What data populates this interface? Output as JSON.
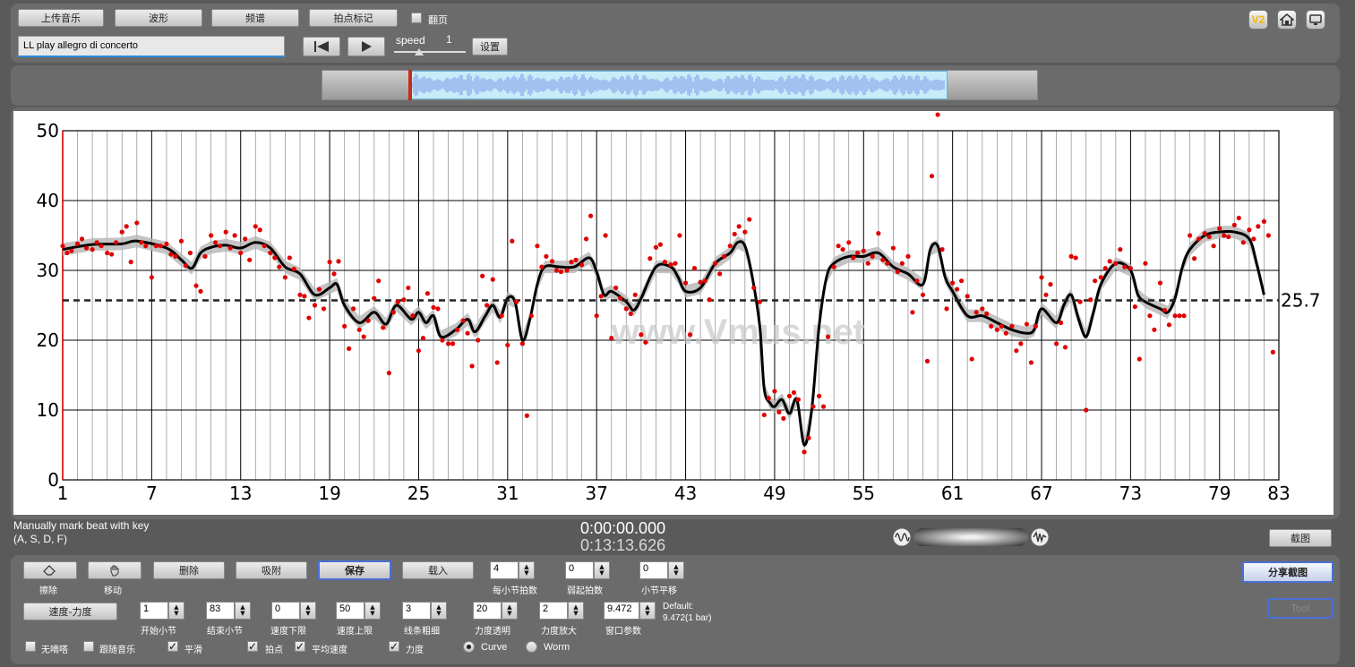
{
  "toolbar": {
    "upload": "上传音乐",
    "waveform": "波形",
    "spectrum": "频谱",
    "beat_mark": "拍点标记",
    "page_turn": "翻页",
    "set": "设置"
  },
  "track": {
    "title": "LL play allegro di concerto"
  },
  "speed": {
    "label": "speed",
    "value": "1"
  },
  "top_icons": {
    "v2": "V2"
  },
  "chart_data": {
    "type": "scatter",
    "ylim": [
      0,
      50
    ],
    "xlim": [
      1,
      83
    ],
    "yticks": [
      "0",
      "10",
      "20",
      "30",
      "40",
      "50"
    ],
    "xticks": [
      "1",
      "7",
      "13",
      "19",
      "25",
      "31",
      "37",
      "43",
      "49",
      "55",
      "61",
      "67",
      "73",
      "79",
      "83"
    ],
    "mean_label": "25.7",
    "mean": 25.7,
    "watermark": "www.Vmus.net",
    "point_color": "#e00000",
    "curve_color": "#000000",
    "curve": [
      [
        1,
        33
      ],
      [
        3,
        33.7
      ],
      [
        5,
        33.8
      ],
      [
        6,
        34.2
      ],
      [
        8,
        33.2
      ],
      [
        9,
        31.5
      ],
      [
        9.7,
        30.3
      ],
      [
        10.3,
        32.5
      ],
      [
        11,
        33.3
      ],
      [
        12,
        33.6
      ],
      [
        13,
        33.2
      ],
      [
        14,
        34
      ],
      [
        15,
        33.2
      ],
      [
        16,
        30.5
      ],
      [
        17,
        29.5
      ],
      [
        18,
        26.5
      ],
      [
        19,
        27.5
      ],
      [
        19.5,
        28
      ],
      [
        20,
        25
      ],
      [
        21,
        22.5
      ],
      [
        22,
        24
      ],
      [
        22.8,
        22.3
      ],
      [
        23.5,
        25
      ],
      [
        24.5,
        23
      ],
      [
        25,
        24
      ],
      [
        25.5,
        22.5
      ],
      [
        26,
        23.5
      ],
      [
        26.5,
        20.5
      ],
      [
        27.5,
        21.5
      ],
      [
        28.3,
        23
      ],
      [
        28.8,
        21.2
      ],
      [
        29.5,
        23.5
      ],
      [
        30,
        25
      ],
      [
        30.5,
        23.3
      ],
      [
        31,
        26
      ],
      [
        31.5,
        25.5
      ],
      [
        32,
        20
      ],
      [
        32.5,
        23
      ],
      [
        33,
        28
      ],
      [
        33.5,
        30.5
      ],
      [
        34.5,
        30.5
      ],
      [
        35.5,
        30.5
      ],
      [
        36.5,
        31.8
      ],
      [
        37,
        29.8
      ],
      [
        37.5,
        26.5
      ],
      [
        38,
        27
      ],
      [
        39,
        25.5
      ],
      [
        39.5,
        24.3
      ],
      [
        40,
        26
      ],
      [
        41,
        30.5
      ],
      [
        42,
        30.5
      ],
      [
        42.5,
        29
      ],
      [
        43,
        27
      ],
      [
        44,
        27.5
      ],
      [
        45,
        31
      ],
      [
        46,
        32.5
      ],
      [
        46.5,
        34
      ],
      [
        47,
        33.5
      ],
      [
        47.5,
        29
      ],
      [
        48,
        22
      ],
      [
        48.3,
        13
      ],
      [
        48.7,
        11
      ],
      [
        49,
        10.5
      ],
      [
        49.5,
        11.5
      ],
      [
        50,
        9.5
      ],
      [
        50.5,
        11.5
      ],
      [
        51,
        5
      ],
      [
        51.5,
        10
      ],
      [
        52,
        22
      ],
      [
        52.5,
        29
      ],
      [
        53,
        31
      ],
      [
        54,
        32
      ],
      [
        55,
        32
      ],
      [
        56,
        32.5
      ],
      [
        57,
        30.5
      ],
      [
        58,
        29.5
      ],
      [
        59,
        28
      ],
      [
        59.5,
        33
      ],
      [
        60,
        33.5
      ],
      [
        60.5,
        29
      ],
      [
        61,
        27
      ],
      [
        62,
        23.5
      ],
      [
        63,
        23.5
      ],
      [
        64,
        22.5
      ],
      [
        65,
        21.5
      ],
      [
        66,
        21
      ],
      [
        66.5,
        21.5
      ],
      [
        67,
        24.5
      ],
      [
        68,
        22.5
      ],
      [
        68.5,
        25
      ],
      [
        69,
        26.5
      ],
      [
        69.5,
        23
      ],
      [
        70,
        20.5
      ],
      [
        70.5,
        24
      ],
      [
        71,
        28
      ],
      [
        72,
        31
      ],
      [
        73,
        30
      ],
      [
        73.5,
        26.5
      ],
      [
        74,
        25.5
      ],
      [
        75,
        24.5
      ],
      [
        75.5,
        24
      ],
      [
        76,
        26
      ],
      [
        76.5,
        30.5
      ],
      [
        77,
        33
      ],
      [
        78,
        35
      ],
      [
        79,
        35.5
      ],
      [
        80,
        35.5
      ],
      [
        81,
        34.5
      ],
      [
        81.5,
        31
      ],
      [
        82,
        26.5
      ]
    ],
    "points": [
      [
        1,
        33.5
      ],
      [
        1.3,
        32.5
      ],
      [
        1.6,
        32.8
      ],
      [
        2,
        33.8
      ],
      [
        2.3,
        34.5
      ],
      [
        2.6,
        33.2
      ],
      [
        3,
        33
      ],
      [
        3.3,
        34
      ],
      [
        3.6,
        33.5
      ],
      [
        4,
        32.5
      ],
      [
        4.3,
        32.3
      ],
      [
        4.6,
        34
      ],
      [
        5,
        35.5
      ],
      [
        5.3,
        36.3
      ],
      [
        5.6,
        31.2
      ],
      [
        6,
        36.8
      ],
      [
        6.3,
        34
      ],
      [
        6.6,
        33.5
      ],
      [
        7,
        29
      ],
      [
        7.3,
        33.5
      ],
      [
        7.6,
        33.5
      ],
      [
        8,
        33.8
      ],
      [
        8.3,
        32.3
      ],
      [
        8.6,
        32
      ],
      [
        9,
        34.2
      ],
      [
        9.3,
        30.7
      ],
      [
        9.6,
        32.5
      ],
      [
        10,
        27.8
      ],
      [
        10.3,
        27
      ],
      [
        10.6,
        32
      ],
      [
        11,
        35
      ],
      [
        11.3,
        34
      ],
      [
        11.6,
        33.5
      ],
      [
        12,
        35.5
      ],
      [
        12.3,
        33.2
      ],
      [
        12.6,
        35
      ],
      [
        13,
        32.5
      ],
      [
        13.3,
        34.5
      ],
      [
        13.6,
        31.5
      ],
      [
        14,
        36.3
      ],
      [
        14.3,
        35.8
      ],
      [
        14.6,
        33.5
      ],
      [
        15,
        32.5
      ],
      [
        15.3,
        31.8
      ],
      [
        15.6,
        30.5
      ],
      [
        16,
        29
      ],
      [
        16.3,
        31.8
      ],
      [
        16.6,
        30.2
      ],
      [
        17,
        26.5
      ],
      [
        17.3,
        26.3
      ],
      [
        17.6,
        23.2
      ],
      [
        18,
        25
      ],
      [
        18.3,
        27.3
      ],
      [
        18.6,
        24.5
      ],
      [
        19,
        31.2
      ],
      [
        19.3,
        29.5
      ],
      [
        19.6,
        31.3
      ],
      [
        20,
        22
      ],
      [
        20.3,
        18.8
      ],
      [
        20.6,
        24.5
      ],
      [
        21,
        21.5
      ],
      [
        21.3,
        20.5
      ],
      [
        21.6,
        22.8
      ],
      [
        22,
        26
      ],
      [
        22.3,
        28.5
      ],
      [
        22.6,
        21.8
      ],
      [
        23,
        15.3
      ],
      [
        23.3,
        24
      ],
      [
        23.6,
        25.5
      ],
      [
        24,
        25.8
      ],
      [
        24.3,
        27.5
      ],
      [
        24.6,
        23.5
      ],
      [
        25,
        18.5
      ],
      [
        25.3,
        20.3
      ],
      [
        25.6,
        26.7
      ],
      [
        26,
        24.7
      ],
      [
        26.3,
        24.5
      ],
      [
        26.6,
        20
      ],
      [
        27,
        19.5
      ],
      [
        27.3,
        19.5
      ],
      [
        27.6,
        21.5
      ],
      [
        28,
        22.8
      ],
      [
        28.3,
        21
      ],
      [
        28.6,
        16.3
      ],
      [
        29,
        20
      ],
      [
        29.3,
        29.2
      ],
      [
        29.6,
        25
      ],
      [
        30,
        28.7
      ],
      [
        30.3,
        16.8
      ],
      [
        30.6,
        23.5
      ],
      [
        31,
        19.3
      ],
      [
        31.3,
        34.2
      ],
      [
        31.6,
        25.5
      ],
      [
        32,
        19.5
      ],
      [
        32.3,
        9.2
      ],
      [
        32.6,
        23.5
      ],
      [
        33,
        33.5
      ],
      [
        33.3,
        30.5
      ],
      [
        33.6,
        32
      ],
      [
        34,
        31.3
      ],
      [
        34.3,
        30
      ],
      [
        34.6,
        29.8
      ],
      [
        35,
        30
      ],
      [
        35.3,
        31.2
      ],
      [
        35.6,
        31.5
      ],
      [
        36,
        30.8
      ],
      [
        36.3,
        34.5
      ],
      [
        36.6,
        37.8
      ],
      [
        37,
        23.5
      ],
      [
        37.3,
        26.3
      ],
      [
        37.6,
        35
      ],
      [
        38,
        20.3
      ],
      [
        38.3,
        27.5
      ],
      [
        38.6,
        26
      ],
      [
        39,
        24.5
      ],
      [
        39.3,
        23.8
      ],
      [
        39.6,
        26.5
      ],
      [
        40,
        20.8
      ],
      [
        40.3,
        19.7
      ],
      [
        40.6,
        31.7
      ],
      [
        41,
        33.3
      ],
      [
        41.3,
        33.7
      ],
      [
        41.6,
        31.2
      ],
      [
        42,
        30.8
      ],
      [
        42.3,
        31
      ],
      [
        42.6,
        35
      ],
      [
        43,
        28.2
      ],
      [
        43.3,
        20.8
      ],
      [
        43.6,
        30.3
      ],
      [
        44,
        28.3
      ],
      [
        44.3,
        28.5
      ],
      [
        44.6,
        25.8
      ],
      [
        45,
        31
      ],
      [
        45.3,
        29.5
      ],
      [
        45.6,
        32
      ],
      [
        46,
        33.5
      ],
      [
        46.3,
        35.2
      ],
      [
        46.6,
        36.3
      ],
      [
        47,
        35.5
      ],
      [
        47.3,
        37.3
      ],
      [
        47.6,
        27.5
      ],
      [
        48,
        25.5
      ],
      [
        48.3,
        9.3
      ],
      [
        48.6,
        11.7
      ],
      [
        49,
        12.7
      ],
      [
        49.3,
        9.7
      ],
      [
        49.6,
        8.8
      ],
      [
        50,
        12
      ],
      [
        50.3,
        12.5
      ],
      [
        50.6,
        11.5
      ],
      [
        51,
        4
      ],
      [
        51.3,
        6
      ],
      [
        51.6,
        10.5
      ],
      [
        52,
        12
      ],
      [
        52.3,
        10.5
      ],
      [
        52.6,
        20.5
      ],
      [
        53,
        30.5
      ],
      [
        53.3,
        33.5
      ],
      [
        53.6,
        33
      ],
      [
        54,
        34
      ],
      [
        54.3,
        31.8
      ],
      [
        54.6,
        32.5
      ],
      [
        55,
        32.8
      ],
      [
        55.3,
        31
      ],
      [
        55.6,
        32
      ],
      [
        56,
        35.3
      ],
      [
        56.3,
        31.5
      ],
      [
        56.6,
        31
      ],
      [
        57,
        33.2
      ],
      [
        57.3,
        29.8
      ],
      [
        57.6,
        31
      ],
      [
        58,
        32
      ],
      [
        58.3,
        24
      ],
      [
        58.6,
        28.5
      ],
      [
        59,
        26.5
      ],
      [
        59.3,
        17
      ],
      [
        59.6,
        43.5
      ],
      [
        60,
        52.3
      ],
      [
        60.3,
        33
      ],
      [
        60.6,
        24.5
      ],
      [
        61,
        28.2
      ],
      [
        61.3,
        27.3
      ],
      [
        61.6,
        28.5
      ],
      [
        62,
        26.3
      ],
      [
        62.3,
        17.3
      ],
      [
        62.6,
        24
      ],
      [
        63,
        24.5
      ],
      [
        63.3,
        23.8
      ],
      [
        63.6,
        22
      ],
      [
        64,
        21.5
      ],
      [
        64.3,
        22
      ],
      [
        64.6,
        21
      ],
      [
        65,
        22
      ],
      [
        65.3,
        18.5
      ],
      [
        65.6,
        19.5
      ],
      [
        66,
        22.3
      ],
      [
        66.3,
        16.8
      ],
      [
        66.6,
        22
      ],
      [
        67,
        29
      ],
      [
        67.3,
        26.5
      ],
      [
        67.6,
        28
      ],
      [
        68,
        19.5
      ],
      [
        68.3,
        22.5
      ],
      [
        68.6,
        19
      ],
      [
        69,
        32
      ],
      [
        69.3,
        31.8
      ],
      [
        69.6,
        25.5
      ],
      [
        70,
        10
      ],
      [
        70.3,
        25.8
      ],
      [
        70.6,
        28.5
      ],
      [
        71,
        29
      ],
      [
        71.3,
        30.3
      ],
      [
        71.6,
        31.3
      ],
      [
        72,
        31
      ],
      [
        72.3,
        33
      ],
      [
        72.6,
        30.5
      ],
      [
        73,
        30.3
      ],
      [
        73.3,
        24.8
      ],
      [
        73.6,
        17.3
      ],
      [
        74,
        31
      ],
      [
        74.3,
        23.5
      ],
      [
        74.6,
        21.5
      ],
      [
        75,
        28.2
      ],
      [
        75.3,
        24.3
      ],
      [
        75.6,
        22.2
      ],
      [
        76,
        23.5
      ],
      [
        76.3,
        23.5
      ],
      [
        76.6,
        23.5
      ],
      [
        77,
        35
      ],
      [
        77.3,
        31.7
      ],
      [
        77.6,
        34.5
      ],
      [
        78,
        35.3
      ],
      [
        78.3,
        34.8
      ],
      [
        78.6,
        33.5
      ],
      [
        79,
        36
      ],
      [
        79.3,
        35
      ],
      [
        79.6,
        34.8
      ],
      [
        80,
        36.5
      ],
      [
        80.3,
        37.5
      ],
      [
        80.6,
        34
      ],
      [
        81,
        35.8
      ],
      [
        81.3,
        34.5
      ],
      [
        81.6,
        36.3
      ],
      [
        82,
        37
      ],
      [
        82.3,
        35
      ],
      [
        82.6,
        18.3
      ]
    ]
  },
  "status": {
    "hint_line1": "Manually mark beat with key",
    "hint_line2": "(A, S, D, F)",
    "time_current": "0:00:00.000",
    "time_total": "0:13:13.626",
    "screenshot": "截图"
  },
  "controls": {
    "erase": "擦除",
    "move": "移动",
    "delete": "删除",
    "snap": "吸附",
    "save": "保存",
    "load": "载入",
    "beats_per_bar": {
      "value": "4",
      "label": "每小节拍数"
    },
    "pickup": {
      "value": "0",
      "label": "弱起拍数"
    },
    "bar_shift": {
      "value": "0",
      "label": "小节平移"
    },
    "share": "分享截图",
    "tool": "Tool",
    "mode": "速度-力度",
    "start_bar": {
      "value": "1",
      "label": "开始小节"
    },
    "end_bar": {
      "value": "83",
      "label": "结束小节"
    },
    "speed_min": {
      "value": "0",
      "label": "速度下限"
    },
    "speed_max": {
      "value": "50",
      "label": "速度上限"
    },
    "line_width": {
      "value": "3",
      "label": "线条粗细"
    },
    "dyn_transparency": {
      "value": "20",
      "label": "力度透明"
    },
    "dyn_zoom": {
      "value": "2",
      "label": "力度放大"
    },
    "window": {
      "value": "9.472",
      "label": "窗口参数"
    },
    "default_label": "Default:",
    "default_value": "9.472(1 bar)",
    "checks": {
      "mute": "无嘀嗒",
      "follow": "跟随音乐",
      "smooth": "平滑",
      "beat_point": "拍点",
      "avg_speed": "平均速度",
      "dynamics": "力度",
      "curve": "Curve",
      "worm": "Worm"
    }
  }
}
